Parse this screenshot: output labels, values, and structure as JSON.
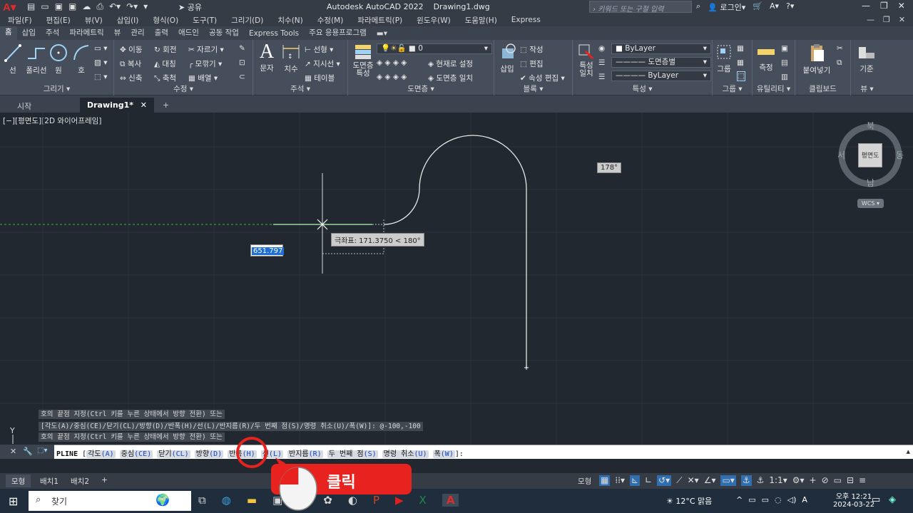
{
  "title_bar": {
    "share_label": "공유",
    "app_title": "Autodesk AutoCAD 2022    Drawing1.dwg",
    "search_placeholder": "키워드 또는 구절 입력",
    "login_label": "로그인"
  },
  "menu_bar": {
    "items": [
      "파일(F)",
      "편집(E)",
      "뷰(V)",
      "삽입(I)",
      "형식(O)",
      "도구(T)",
      "그리기(D)",
      "치수(N)",
      "수정(M)",
      "파라메트릭(P)",
      "윈도우(W)",
      "도움말(H)",
      "Express"
    ]
  },
  "ribbon_tabs": {
    "items": [
      "홈",
      "삽입",
      "주석",
      "파라메트릭",
      "뷰",
      "관리",
      "출력",
      "애드인",
      "공동 작업",
      "Express Tools",
      "주요 응용프로그램"
    ],
    "active": "홈"
  },
  "ribbon": {
    "draw": {
      "title": "그리기 ▾",
      "line": "선",
      "polyline": "폴리선",
      "circle": "원",
      "arc": "호"
    },
    "modify": {
      "title": "수정 ▾",
      "move": "이동",
      "rotate": "회전",
      "trim": "자르기",
      "copy": "복사",
      "mirror": "대칭",
      "fillet": "모깎기",
      "stretch": "신축",
      "scale": "축척",
      "array": "배열"
    },
    "annotation": {
      "title": "주석 ▾",
      "text": "문자",
      "dimension": "치수",
      "linear": "선형",
      "leader": "지시선",
      "table": "테이블"
    },
    "layers": {
      "title": "도면층 ▾",
      "properties": "도면층\n특성",
      "current_layer": "0",
      "make_current": "현재로 설정",
      "match": "도면층 일치"
    },
    "block": {
      "title": "블록 ▾",
      "insert": "삽입",
      "create": "작성",
      "edit": "편집",
      "edit_attributes": "속성 편집"
    },
    "properties": {
      "title": "특성 ▾",
      "match": "특성\n일치",
      "color": "ByLayer",
      "linetype": "도면층별",
      "lineweight": "ByLayer"
    },
    "groups": {
      "title": "그룹 ▾",
      "group": "그룹"
    },
    "utilities": {
      "title": "유틸리티 ▾",
      "measure": "측정"
    },
    "clipboard": {
      "title": "클립보드",
      "paste": "붙여넣기"
    },
    "view": {
      "title": "뷰 ▾",
      "base": "기준"
    }
  },
  "doc_tabs": {
    "start": "시작",
    "drawing": "Drawing1*"
  },
  "drawing": {
    "view_label": "[−][평면도][2D 와이어프레임]",
    "angle_tooltip": "178°",
    "polar_tooltip": "극좌표: 171.3750 < 180°",
    "distance_input": "651.797",
    "viewcube": {
      "north": "북",
      "south": "남",
      "east": "동",
      "west": "서",
      "face": "평면도",
      "wcs": "WCS"
    }
  },
  "command_history": [
    "호의 끝점 지정(Ctrl 키를 누른 상태에서 방향 전환) 또는",
    "[각도(A)/중심(CE)/닫기(CL)/방향(D)/반폭(H)/선(L)/반지름(R)/두 번째 점(S)/명령 취소(U)/폭(W)]: @-100,-100",
    "호의 끝점 지정(Ctrl 키를 누른 상태에서 방향 전환) 또는"
  ],
  "command_line": {
    "command": "PLINE",
    "options": [
      {
        "label": "각도",
        "key": "(A)"
      },
      {
        "label": "중심",
        "key": "(CE)"
      },
      {
        "label": "닫기",
        "key": "(CL)"
      },
      {
        "label": "방향",
        "key": "(D)"
      },
      {
        "label": "반폭",
        "key": "(H)"
      },
      {
        "label": "선",
        "key": "(L)"
      },
      {
        "label": "반지름",
        "key": "(R)"
      },
      {
        "label": "두 번째 점",
        "key": "(S)"
      },
      {
        "label": "명령 취소",
        "key": "(U)"
      },
      {
        "label": "폭",
        "key": "(W)"
      }
    ]
  },
  "status_bar": {
    "model_tab": "모형",
    "layout1": "배치1",
    "layout2": "배치2",
    "model_label": "모형",
    "scale": "1:1"
  },
  "annotation": {
    "label": "클릭"
  },
  "taskbar": {
    "search": "찾기",
    "weather": "12°C 맑음",
    "time": "오후 12:21",
    "date": "2024-03-22"
  },
  "colors": {
    "accent_red": "#e8221e",
    "drawing_bg": "#212830",
    "ribbon_bg": "#454e5a"
  }
}
